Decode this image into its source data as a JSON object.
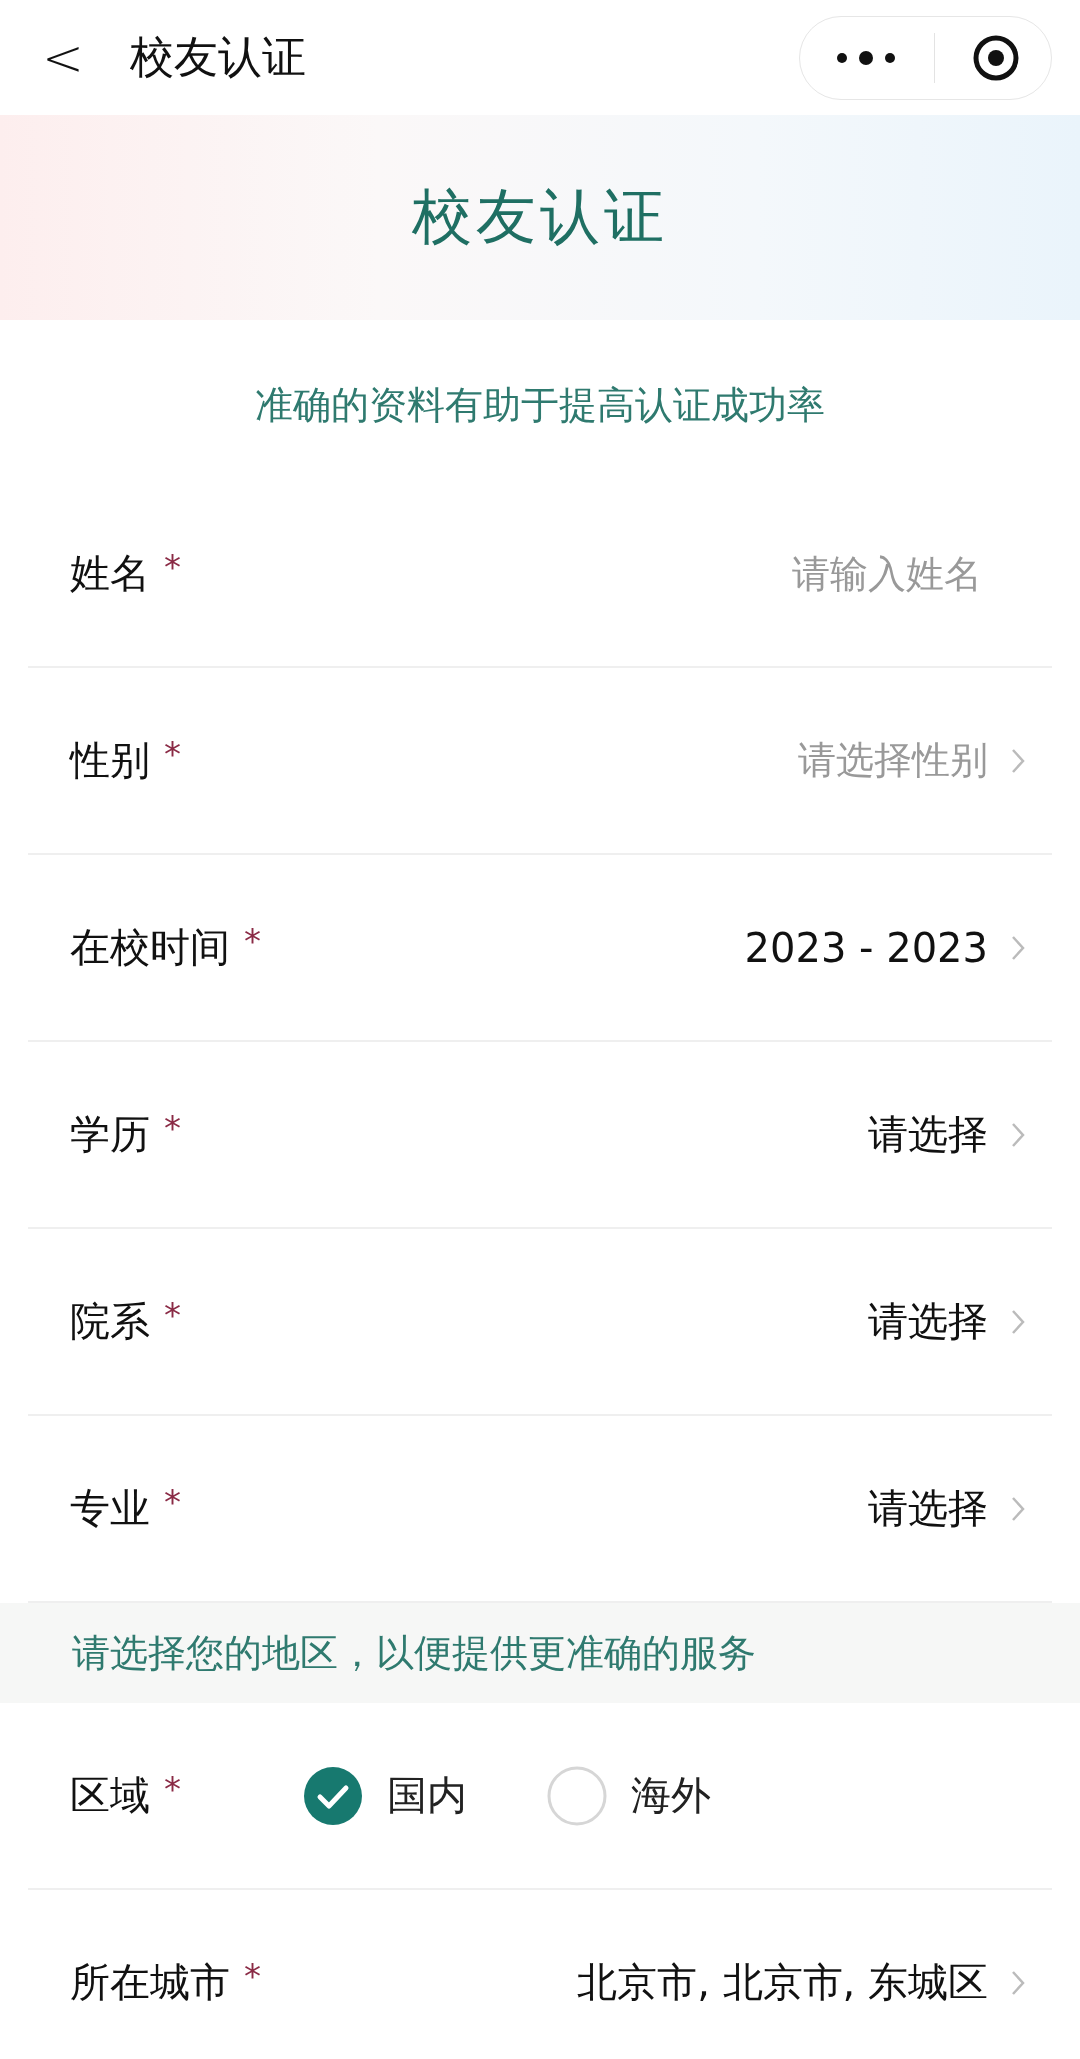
{
  "nav_bar": {
    "back": "<",
    "title": "校友认证"
  },
  "header": {
    "title": "校友认证",
    "subtitle": "准确的资料有助于提高认证成功率"
  },
  "fields": [
    {
      "kind": "input",
      "label": "姓名",
      "required_mark": "*",
      "placeholder": "请输入姓名"
    },
    {
      "kind": "select",
      "label": "性别",
      "required_mark": "*",
      "placeholder": "请选择性别"
    },
    {
      "kind": "select",
      "label": "在校时间",
      "required_mark": "*",
      "value": "2023 - 2023"
    },
    {
      "kind": "select",
      "label": "学历",
      "required_mark": "*",
      "value": "请选择"
    },
    {
      "kind": "select",
      "label": "院系",
      "required_mark": "*",
      "value": "请选择"
    },
    {
      "kind": "select",
      "label": "专业",
      "required_mark": "*",
      "value": "请选择"
    }
  ],
  "region_note": "请选择您的地区，以便提供更准确的服务",
  "region_fields": [
    {
      "kind": "radio",
      "label": "区域",
      "required_mark": "*",
      "options": [
        {
          "label": "国内",
          "selected": true
        },
        {
          "label": "海外",
          "selected": false
        }
      ]
    },
    {
      "kind": "select",
      "label": "所在城市",
      "required_mark": "*",
      "value": "北京市, 北京市, 东城区"
    }
  ]
}
